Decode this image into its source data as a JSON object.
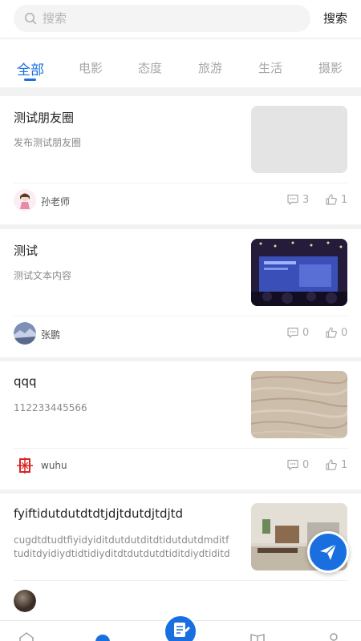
{
  "search": {
    "placeholder": "搜索",
    "button_label": "搜索"
  },
  "tabs": [
    {
      "label": "全部",
      "active": true
    },
    {
      "label": "电影",
      "active": false
    },
    {
      "label": "态度",
      "active": false
    },
    {
      "label": "旅游",
      "active": false
    },
    {
      "label": "生活",
      "active": false
    },
    {
      "label": "摄影",
      "active": false
    }
  ],
  "posts": [
    {
      "title": "测试朋友圈",
      "desc": "发布测试朋友圈",
      "author": "孙老师",
      "comments": "3",
      "likes": "1",
      "thumb": "blank-gray",
      "avatar": "cartoon-girl"
    },
    {
      "title": "测试",
      "desc": "测试文本内容",
      "author": "张鹏",
      "comments": "0",
      "likes": "0",
      "thumb": "conference-screen",
      "avatar": "landscape"
    },
    {
      "title": "qqq",
      "desc": "112233445566",
      "author": "wuhu",
      "comments": "0",
      "likes": "1",
      "thumb": "wood-grain",
      "avatar": "red-seal"
    },
    {
      "title": "fyiftidutdutdtdtjdjtdutdjtdjtd",
      "desc": "cugdtdtudtfiyidyiditdutdutditdtidutdutdmditftuditdyidiydtidtidiyditdtdutdutdtiditdiydtiditdutdutrtidut…",
      "author": "",
      "comments": "",
      "likes": "",
      "thumb": "living-room",
      "avatar": "dark-sphere"
    }
  ],
  "colors": {
    "accent": "#1a6fe0",
    "text": "#222222",
    "muted": "#a8a8a8"
  },
  "icons": [
    "search-icon",
    "comment-icon",
    "like-icon",
    "send-icon",
    "home-icon",
    "edit-icon",
    "book-icon",
    "user-icon"
  ]
}
